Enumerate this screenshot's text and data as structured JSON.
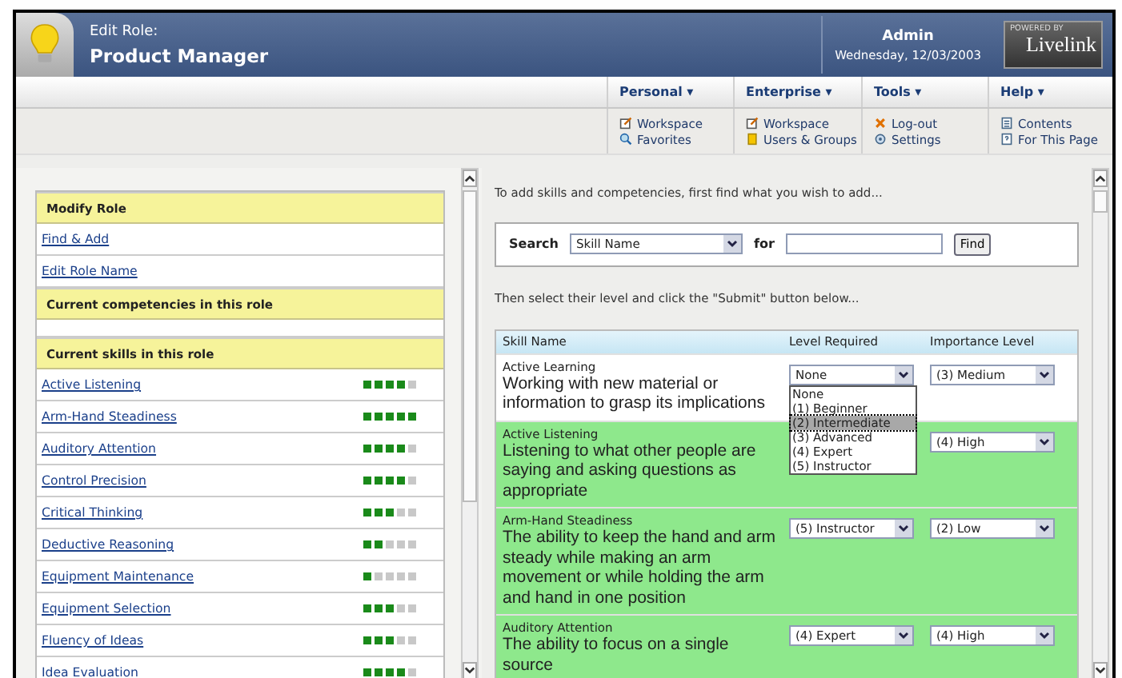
{
  "header": {
    "subtitle": "Edit Role:",
    "title": "Product Manager",
    "user": "Admin",
    "date": "Wednesday, 12/03/2003",
    "badge_top": "POWERED BY",
    "badge_brand": "Livelink"
  },
  "menus": [
    {
      "label": "Personal ▾",
      "items": [
        {
          "label": "Workspace",
          "kind": "edit"
        },
        {
          "label": "Favorites",
          "kind": "search"
        }
      ]
    },
    {
      "label": "Enterprise ▾",
      "items": [
        {
          "label": "Workspace",
          "kind": "edit"
        },
        {
          "label": "Users & Groups",
          "kind": "users"
        }
      ]
    },
    {
      "label": "Tools ▾",
      "items": [
        {
          "label": "Log-out",
          "kind": "logout"
        },
        {
          "label": "Settings",
          "kind": "gear"
        }
      ]
    },
    {
      "label": "Help ▾",
      "items": [
        {
          "label": "Contents",
          "kind": "book"
        },
        {
          "label": "For This Page",
          "kind": "help"
        }
      ]
    }
  ],
  "sidebar": {
    "sections": [
      {
        "heading": "Modify Role",
        "links": [
          "Find & Add",
          "Edit Role Name"
        ]
      },
      {
        "heading": "Current competencies in this role"
      },
      {
        "heading": "Current skills in this role",
        "skills": [
          {
            "name": "Active Listening",
            "stars": 4
          },
          {
            "name": "Arm-Hand Steadiness",
            "stars": 5
          },
          {
            "name": "Auditory Attention",
            "stars": 4
          },
          {
            "name": "Control Precision",
            "stars": 4
          },
          {
            "name": "Critical Thinking",
            "stars": 3
          },
          {
            "name": "Deductive Reasoning",
            "stars": 2
          },
          {
            "name": "Equipment Maintenance",
            "stars": 1
          },
          {
            "name": "Equipment Selection",
            "stars": 3
          },
          {
            "name": "Fluency of Ideas",
            "stars": 3
          },
          {
            "name": "Idea Evaluation",
            "stars": 4
          }
        ]
      }
    ]
  },
  "main": {
    "intro": "To add skills and competencies, first find what you wish to add...",
    "search": {
      "label": "Search",
      "field": "Skill Name",
      "for": "for",
      "button": "Find"
    },
    "instructions": "Then select their level and click the \"Submit\" button below...",
    "table": {
      "columns": [
        "Skill Name",
        "Level Required",
        "Importance Level"
      ],
      "rows": [
        {
          "name": "Active Learning",
          "description": "Working with new material or information to grasp its implications",
          "level": "None",
          "importance": "(3) Medium",
          "highlighted": false,
          "dropdown": [
            {
              "label": "None",
              "selected": false
            },
            {
              "label": "(1) Beginner",
              "selected": false
            },
            {
              "label": "(2) Intermediate",
              "selected": true
            },
            {
              "label": "(3) Advanced",
              "selected": false
            },
            {
              "label": "(4) Expert",
              "selected": false
            },
            {
              "label": "(5) Instructor",
              "selected": false
            }
          ]
        },
        {
          "name": "Active Listening",
          "description": "Listening to what other people are saying and asking questions as appropriate",
          "importance": "(4) High",
          "highlighted": true
        },
        {
          "name": "Arm-Hand Steadiness",
          "description": "The ability to keep the hand and arm steady while making an arm movement or while holding the arm and hand in one position",
          "level": "(5) Instructor",
          "importance": "(2) Low",
          "highlighted": true
        },
        {
          "name": "Auditory Attention",
          "description": "The ability to focus on a single source",
          "level": "(4) Expert",
          "importance": "(4) High",
          "highlighted": true
        }
      ]
    }
  }
}
